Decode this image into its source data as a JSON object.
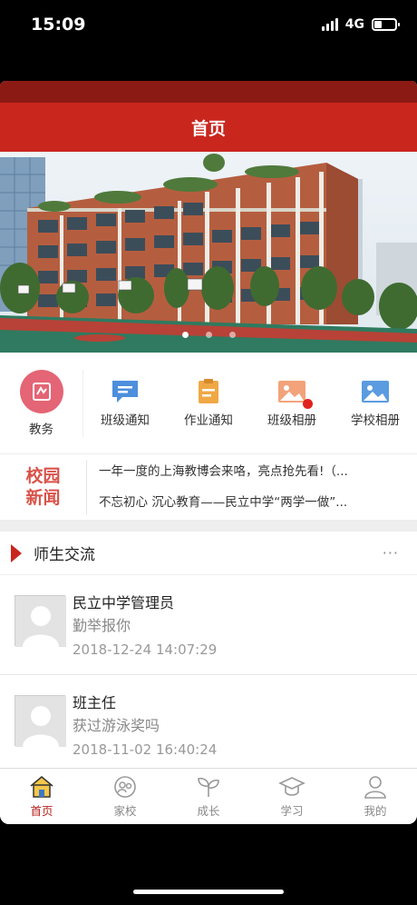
{
  "status_bar": {
    "time": "15:09",
    "network": "4G"
  },
  "header": {
    "title": "首页"
  },
  "banner": {
    "slide_count": 3,
    "active_slide": 1
  },
  "quick_actions": [
    {
      "label": "教务",
      "icon": "academic-affairs-icon"
    },
    {
      "label": "班级通知",
      "icon": "class-notice-icon"
    },
    {
      "label": "作业通知",
      "icon": "homework-notice-icon"
    },
    {
      "label": "班级相册",
      "icon": "class-album-icon",
      "badge": true
    },
    {
      "label": "学校相册",
      "icon": "school-album-icon"
    }
  ],
  "news": {
    "badge_line1": "校园",
    "badge_line2": "新闻",
    "items": [
      "一年一度的上海教博会来咯，亮点抢先看!（...",
      "不忘初心 沉心教育——民立中学“两学一做”..."
    ]
  },
  "section": {
    "title": "师生交流",
    "more": "···"
  },
  "posts": [
    {
      "name": "民立中学管理员",
      "message": "勤举报你",
      "time": "2018-12-24 14:07:29"
    },
    {
      "name": "班主任",
      "message": "获过游泳奖吗",
      "time": "2018-11-02 16:40:24"
    }
  ],
  "tabbar": [
    {
      "label": "首页",
      "icon": "home-icon",
      "active": true
    },
    {
      "label": "家校",
      "icon": "home-school-icon"
    },
    {
      "label": "成长",
      "icon": "sprout-icon"
    },
    {
      "label": "学习",
      "icon": "graduation-cap-icon"
    },
    {
      "label": "我的",
      "icon": "user-icon"
    }
  ],
  "colors": {
    "brand_red": "#c9261e",
    "dark_red": "#8b1a14",
    "badge_red": "#e0231f"
  }
}
